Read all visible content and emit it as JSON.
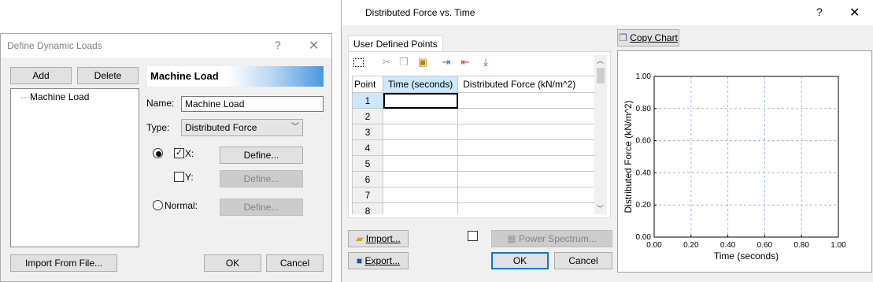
{
  "left_dialog": {
    "title": "Define Dynamic Loads",
    "help_glyph": "?",
    "close_glyph": "✕",
    "add_label": "Add",
    "delete_label": "Delete",
    "tree_item": "Machine Load",
    "header": "Machine Load",
    "name_label": "Name:",
    "name_value": "Machine Load",
    "type_label": "Type:",
    "type_value": "Distributed Force",
    "x_label": "X:",
    "y_label": "Y:",
    "normal_label": "Normal:",
    "define_label": "Define...",
    "import_label": "Import From File...",
    "ok_label": "OK",
    "cancel_label": "Cancel"
  },
  "right_dialog": {
    "title": "Distributed Force vs. Time",
    "help_glyph": "?",
    "close_glyph": "✕",
    "tab_label": "User Defined Points",
    "copy_chart_label": "Copy Chart",
    "grid": {
      "columns": [
        "Point",
        "Time (seconds)",
        "Distributed Force (kN/m^2)"
      ],
      "rows": [
        "1",
        "2",
        "3",
        "4",
        "5",
        "6",
        "7",
        "8"
      ]
    },
    "import_label": "Import...",
    "export_label": "Export...",
    "power_spectrum_label": "Power Spectrum...",
    "ok_label": "OK",
    "cancel_label": "Cancel"
  },
  "chart_data": {
    "type": "line",
    "series": [],
    "xlabel": "Time (seconds)",
    "ylabel": "Distributed Force (kN/m^2)",
    "xlim": [
      0,
      1
    ],
    "ylim": [
      0,
      1
    ],
    "xticks": [
      "0.00",
      "0.20",
      "0.40",
      "0.60",
      "0.80",
      "1.00"
    ],
    "yticks": [
      "0.00",
      "0.20",
      "0.40",
      "0.60",
      "0.80",
      "1.00"
    ],
    "grid": true
  }
}
